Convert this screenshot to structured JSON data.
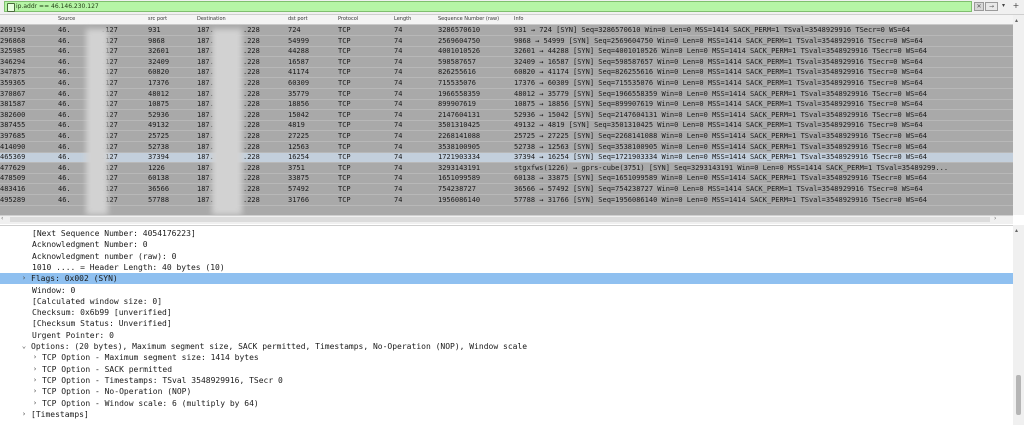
{
  "filter": {
    "value": "ip.addr == 46.146.230.127",
    "clear_icon": "x-icon",
    "apply_icon": "arrow-right-icon"
  },
  "columns": [
    "Source",
    "src port",
    "Destination",
    "dst port",
    "Protocol",
    "Length",
    "Sequence Number (raw)",
    "Info"
  ],
  "packets": [
    {
      "no": "269194",
      "src": "46.",
      "src_tail": ".127",
      "sport": "931",
      "dst": "187.",
      "dst_tail": ".228",
      "dport": "724",
      "proto": "TCP",
      "len": "74",
      "seq": "3286570610",
      "info": "931 → 724 [SYN] Seq=3286570610 Win=0 Len=0 MSS=1414 SACK_PERM=1 TSval=3548929916 TSecr=0 WS=64"
    },
    {
      "no": "296868",
      "src": "46.",
      "src_tail": ".127",
      "sport": "9868",
      "dst": "187.",
      "dst_tail": ".228",
      "dport": "54999",
      "proto": "TCP",
      "len": "74",
      "seq": "2569604750",
      "info": "9868 → 54999 [SYN] Seq=2569604750 Win=0 Len=0 MSS=1414 SACK_PERM=1 TSval=3548929916 TSecr=0 WS=64"
    },
    {
      "no": "325985",
      "src": "46.",
      "src_tail": ".127",
      "sport": "32601",
      "dst": "187.",
      "dst_tail": ".228",
      "dport": "44288",
      "proto": "TCP",
      "len": "74",
      "seq": "4001010526",
      "info": "32601 → 44288 [SYN] Seq=4001010526 Win=0 Len=0 MSS=1414 SACK_PERM=1 TSval=3548929916 TSecr=0 WS=64"
    },
    {
      "no": "346294",
      "src": "46.",
      "src_tail": ".127",
      "sport": "32409",
      "dst": "187.",
      "dst_tail": ".228",
      "dport": "16587",
      "proto": "TCP",
      "len": "74",
      "seq": "598587657",
      "info": "32409 → 16587 [SYN] Seq=598587657 Win=0 Len=0 MSS=1414 SACK_PERM=1 TSval=3548929916 TSecr=0 WS=64"
    },
    {
      "no": "347875",
      "src": "46.",
      "src_tail": ".127",
      "sport": "60820",
      "dst": "187.",
      "dst_tail": ".228",
      "dport": "41174",
      "proto": "TCP",
      "len": "74",
      "seq": "826255616",
      "info": "60820 → 41174 [SYN] Seq=826255616 Win=0 Len=0 MSS=1414 SACK_PERM=1 TSval=3548929916 TSecr=0 WS=64"
    },
    {
      "no": "359365",
      "src": "46.",
      "src_tail": ".127",
      "sport": "17376",
      "dst": "187.",
      "dst_tail": ".228",
      "dport": "60309",
      "proto": "TCP",
      "len": "74",
      "seq": "715535076",
      "info": "17376 → 60309 [SYN] Seq=715535076 Win=0 Len=0 MSS=1414 SACK_PERM=1 TSval=3548929916 TSecr=0 WS=64"
    },
    {
      "no": "370867",
      "src": "46.",
      "src_tail": ".127",
      "sport": "48012",
      "dst": "187.",
      "dst_tail": ".228",
      "dport": "35779",
      "proto": "TCP",
      "len": "74",
      "seq": "1966558359",
      "info": "48012 → 35779 [SYN] Seq=1966558359 Win=0 Len=0 MSS=1414 SACK_PERM=1 TSval=3548929916 TSecr=0 WS=64"
    },
    {
      "no": "381587",
      "src": "46.",
      "src_tail": ".127",
      "sport": "10875",
      "dst": "187.",
      "dst_tail": ".228",
      "dport": "18856",
      "proto": "TCP",
      "len": "74",
      "seq": "899907619",
      "info": "10875 → 18856 [SYN] Seq=899907619 Win=0 Len=0 MSS=1414 SACK_PERM=1 TSval=3548929916 TSecr=0 WS=64"
    },
    {
      "no": "382600",
      "src": "46.",
      "src_tail": ".127",
      "sport": "52936",
      "dst": "187.",
      "dst_tail": ".228",
      "dport": "15042",
      "proto": "TCP",
      "len": "74",
      "seq": "2147604131",
      "info": "52936 → 15042 [SYN] Seq=2147604131 Win=0 Len=0 MSS=1414 SACK_PERM=1 TSval=3548929916 TSecr=0 WS=64"
    },
    {
      "no": "387455",
      "src": "46.",
      "src_tail": ".127",
      "sport": "49132",
      "dst": "187.",
      "dst_tail": ".228",
      "dport": "4819",
      "proto": "TCP",
      "len": "74",
      "seq": "3501310425",
      "info": "49132 → 4819 [SYN] Seq=3501310425 Win=0 Len=0 MSS=1414 SACK_PERM=1 TSval=3548929916 TSecr=0 WS=64"
    },
    {
      "no": "397685",
      "src": "46.",
      "src_tail": ".127",
      "sport": "25725",
      "dst": "187.",
      "dst_tail": ".228",
      "dport": "27225",
      "proto": "TCP",
      "len": "74",
      "seq": "2268141088",
      "info": "25725 → 27225 [SYN] Seq=2268141088 Win=0 Len=0 MSS=1414 SACK_PERM=1 TSval=3548929916 TSecr=0 WS=64"
    },
    {
      "no": "414090",
      "src": "46.",
      "src_tail": ".127",
      "sport": "52738",
      "dst": "187.",
      "dst_tail": ".228",
      "dport": "12563",
      "proto": "TCP",
      "len": "74",
      "seq": "3538100905",
      "info": "52738 → 12563 [SYN] Seq=3538100905 Win=0 Len=0 MSS=1414 SACK_PERM=1 TSval=3548929916 TSecr=0 WS=64"
    },
    {
      "no": "465369",
      "src": "46.",
      "src_tail": ".127",
      "sport": "37394",
      "dst": "187.",
      "dst_tail": ".228",
      "dport": "16254",
      "proto": "TCP",
      "len": "74",
      "seq": "1721903334",
      "info": "37394 → 16254 [SYN] Seq=1721903334 Win=0 Len=0 MSS=1414 SACK_PERM=1 TSval=3548929916 TSecr=0 WS=64"
    },
    {
      "no": "477629",
      "src": "46.",
      "src_tail": ".127",
      "sport": "1226",
      "dst": "187.",
      "dst_tail": ".228",
      "dport": "3751",
      "proto": "TCP",
      "len": "74",
      "seq": "3293143191",
      "info": "stgxfws(1226) → gprs-cube(3751) [SYN] Seq=3293143191 Win=0 Len=0 MSS=1414 SACK_PERM=1 TSval=35489299..."
    },
    {
      "no": "478509",
      "src": "46.",
      "src_tail": ".127",
      "sport": "60138",
      "dst": "187.",
      "dst_tail": ".228",
      "dport": "33875",
      "proto": "TCP",
      "len": "74",
      "seq": "1651099589",
      "info": "60138 → 33875 [SYN] Seq=1651099589 Win=0 Len=0 MSS=1414 SACK_PERM=1 TSval=3548929916 TSecr=0 WS=64"
    },
    {
      "no": "483416",
      "src": "46.",
      "src_tail": ".127",
      "sport": "36566",
      "dst": "187.",
      "dst_tail": ".228",
      "dport": "57492",
      "proto": "TCP",
      "len": "74",
      "seq": "754238727",
      "info": "36566 → 57492 [SYN] Seq=754238727 Win=0 Len=0 MSS=1414 SACK_PERM=1 TSval=3548929916 TSecr=0 WS=64"
    },
    {
      "no": "495289",
      "src": "46.",
      "src_tail": ".127",
      "sport": "57788",
      "dst": "187.",
      "dst_tail": ".228",
      "dport": "31766",
      "proto": "TCP",
      "len": "74",
      "seq": "1956086140",
      "info": "57788 → 31766 [SYN] Seq=1956086140 Win=0 Len=0 MSS=1414 SACK_PERM=1 TSval=3548929916 TSecr=0 WS=64"
    }
  ],
  "selected_packet_index": 12,
  "details": [
    {
      "indent": 1,
      "arrow": "",
      "text": "[Next Sequence Number: 4054176223]",
      "highlight": false
    },
    {
      "indent": 1,
      "arrow": "",
      "text": "Acknowledgment Number: 0",
      "highlight": false
    },
    {
      "indent": 1,
      "arrow": "",
      "text": "Acknowledgment number (raw): 0",
      "highlight": false
    },
    {
      "indent": 1,
      "arrow": "",
      "text": "1010 .... = Header Length: 40 bytes (10)",
      "highlight": false
    },
    {
      "indent": 0,
      "arrow": "›",
      "text": "Flags: 0x002 (SYN)",
      "highlight": true
    },
    {
      "indent": 1,
      "arrow": "",
      "text": "Window: 0",
      "highlight": false
    },
    {
      "indent": 1,
      "arrow": "",
      "text": "[Calculated window size: 0]",
      "highlight": false
    },
    {
      "indent": 1,
      "arrow": "",
      "text": "Checksum: 0x6b99 [unverified]",
      "highlight": false
    },
    {
      "indent": 1,
      "arrow": "",
      "text": "[Checksum Status: Unverified]",
      "highlight": false
    },
    {
      "indent": 1,
      "arrow": "",
      "text": "Urgent Pointer: 0",
      "highlight": false
    },
    {
      "indent": 0,
      "arrow": "⌄",
      "text": "Options: (20 bytes), Maximum segment size, SACK permitted, Timestamps, No-Operation (NOP), Window scale",
      "highlight": false
    },
    {
      "indent": 2,
      "arrow": "›",
      "text": "TCP Option - Maximum segment size: 1414 bytes",
      "highlight": false
    },
    {
      "indent": 2,
      "arrow": "›",
      "text": "TCP Option - SACK permitted",
      "highlight": false
    },
    {
      "indent": 2,
      "arrow": "›",
      "text": "TCP Option - Timestamps: TSval 3548929916, TSecr 0",
      "highlight": false
    },
    {
      "indent": 2,
      "arrow": "›",
      "text": "TCP Option - No-Operation (NOP)",
      "highlight": false
    },
    {
      "indent": 2,
      "arrow": "›",
      "text": "TCP Option - Window scale: 6 (multiply by 64)",
      "highlight": false
    },
    {
      "indent": 0,
      "arrow": "›",
      "text": "[Timestamps]",
      "highlight": false
    }
  ],
  "colors": {
    "filter_bg": "#b6f5a6",
    "row_bg": "#a9a9a9",
    "selected_row_bg": "#c3cfdc",
    "detail_highlight": "#8fc0f0"
  }
}
